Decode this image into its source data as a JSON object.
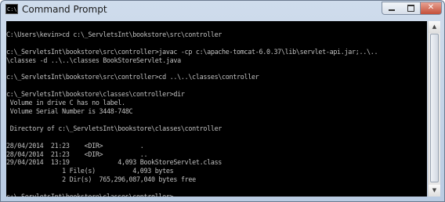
{
  "window": {
    "title": "Command Prompt",
    "app_icon_label": "C:\\",
    "controls": {
      "minimize": "minimize-icon",
      "maximize": "maximize-icon",
      "close": "✕"
    }
  },
  "console": {
    "lines": [
      "",
      "C:\\Users\\kevin>cd c:\\_ServletsInt\\bookstore\\src\\controller",
      "",
      "c:\\_ServletsInt\\bookstore\\src\\controller>javac -cp c:\\apache-tomcat-6.0.37\\lib\\servlet-api.jar;..\\..",
      "\\classes -d ..\\..\\classes BookStoreServlet.java",
      "",
      "c:\\_ServletsInt\\bookstore\\src\\controller>cd ..\\..\\classes\\controller",
      "",
      "c:\\_ServletsInt\\bookstore\\classes\\controller>dir",
      " Volume in drive C has no label.",
      " Volume Serial Number is 3448-748C",
      "",
      " Directory of c:\\_ServletsInt\\bookstore\\classes\\controller",
      "",
      "28/04/2014  21:23    <DIR>          .",
      "28/04/2014  21:23    <DIR>          ..",
      "29/04/2014  13:19             4,093 BookStoreServlet.class",
      "               1 File(s)          4,093 bytes",
      "               2 Dir(s)  765,296,087,040 bytes free",
      "",
      "c:\\_ServletsInt\\bookstore\\classes\\controller>"
    ],
    "text_color": "#c0c0c0",
    "background": "#000000"
  }
}
